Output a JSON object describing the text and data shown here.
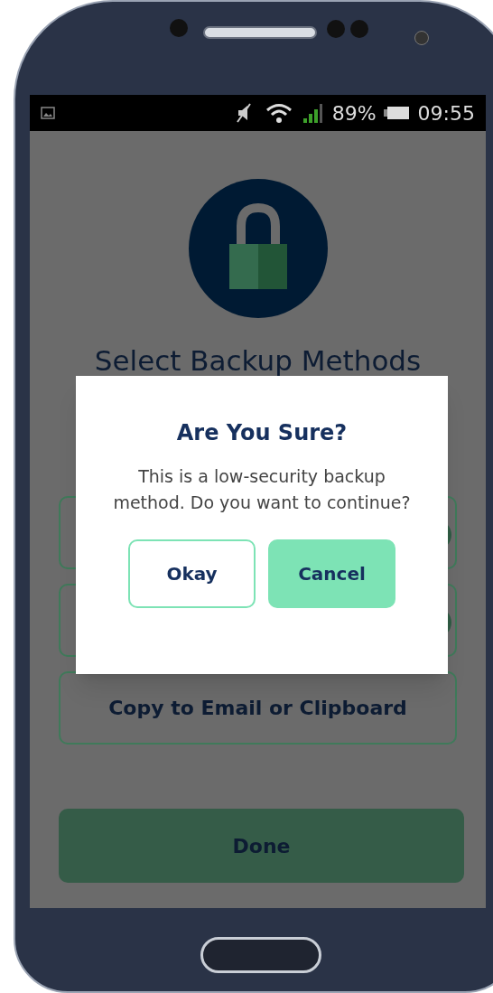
{
  "status_bar": {
    "battery": "89%",
    "time": "09:55"
  },
  "screen": {
    "title": "Select Backup Methods",
    "options": [
      {
        "kind": "toggle"
      },
      {
        "kind": "toggle"
      },
      {
        "kind": "button",
        "label": "Copy to Email or Clipboard"
      }
    ],
    "done_button": "Done"
  },
  "dialog": {
    "title": "Are You Sure?",
    "message": "This is a low-security backup method. Do you want to continue?",
    "buttons": [
      {
        "label": "Okay",
        "kind": "outline"
      },
      {
        "label": "Cancel",
        "kind": "filled"
      }
    ]
  }
}
